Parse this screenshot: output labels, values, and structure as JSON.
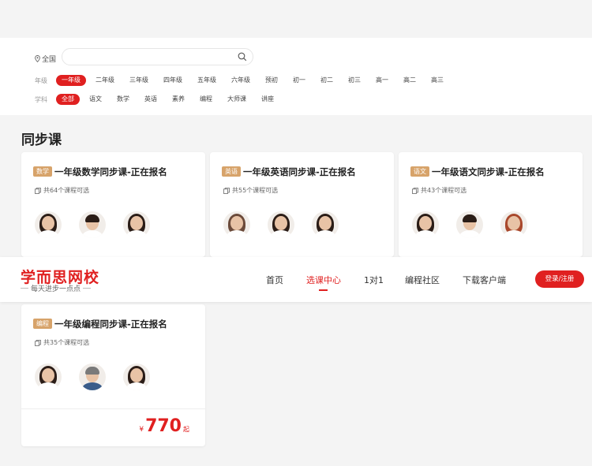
{
  "location": "全国",
  "search": {
    "placeholder": ""
  },
  "grade": {
    "label": "年级",
    "options": [
      "一年级",
      "二年级",
      "三年级",
      "四年级",
      "五年级",
      "六年级",
      "预初",
      "初一",
      "初二",
      "初三",
      "高一",
      "高二",
      "高三"
    ]
  },
  "subject": {
    "label": "学科",
    "options": [
      "全部",
      "语文",
      "数学",
      "英语",
      "素养",
      "编程",
      "大师课",
      "讲座"
    ]
  },
  "section_title": "同步课",
  "cards": [
    {
      "tag": "数学",
      "title": "一年级数学同步课-正在报名",
      "count": "共64个课程可选"
    },
    {
      "tag": "英语",
      "title": "一年级英语同步课-正在报名",
      "count": "共55个课程可选"
    },
    {
      "tag": "语文",
      "title": "一年级语文同步课-正在报名",
      "count": "共43个课程可选"
    },
    {
      "tag": "编程",
      "title": "一年级编程同步课-正在报名",
      "count": "共35个课程可选",
      "price_symbol": "¥",
      "price": "770",
      "price_unit": "起"
    }
  ],
  "header": {
    "logo": "学而思网校",
    "slogan": "每天进步一点点",
    "nav": [
      "首页",
      "选课中心",
      "1对1",
      "编程社区",
      "下载客户端"
    ],
    "login": "登录/注册"
  },
  "colors": {
    "accent": "#e02020",
    "tag": "#d7a36a"
  }
}
